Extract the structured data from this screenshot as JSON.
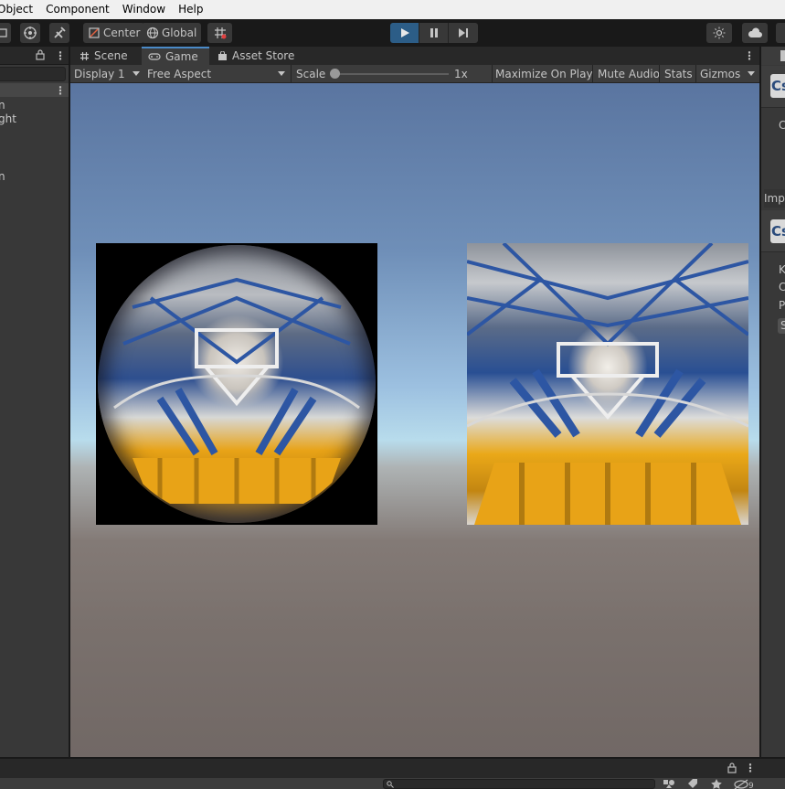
{
  "menu": {
    "items": [
      "Object",
      "Component",
      "Window",
      "Help"
    ]
  },
  "toolbar": {
    "pivot_label": "Center",
    "rotation_label": "Global"
  },
  "hierarchy": {
    "items": [
      "n",
      "ght",
      "",
      "n"
    ]
  },
  "game_view": {
    "tabs": [
      {
        "label": "Scene",
        "icon": "hash-icon"
      },
      {
        "label": "Game",
        "icon": "gamepad-icon"
      },
      {
        "label": "Asset Store",
        "icon": "bag-icon"
      }
    ],
    "display_label": "Display 1",
    "aspect_label": "Free Aspect",
    "scale_label": "Scale",
    "scale_value": "1x",
    "maximize_label": "Maximize On Play",
    "mute_label": "Mute Audio",
    "stats_label": "Stats",
    "gizmos_label": "Gizmos"
  },
  "inspector": {
    "badge_1": "Cs",
    "import_label": "Impo",
    "badge_2": "Cs",
    "letters": [
      "C",
      "K",
      "C",
      "P",
      "S"
    ]
  },
  "colors": {
    "play_active": "#2c5d87",
    "tab_accent": "#4a8ac8",
    "truss_blue": "#2d56a3",
    "mount_yellow": "#e8a317"
  }
}
